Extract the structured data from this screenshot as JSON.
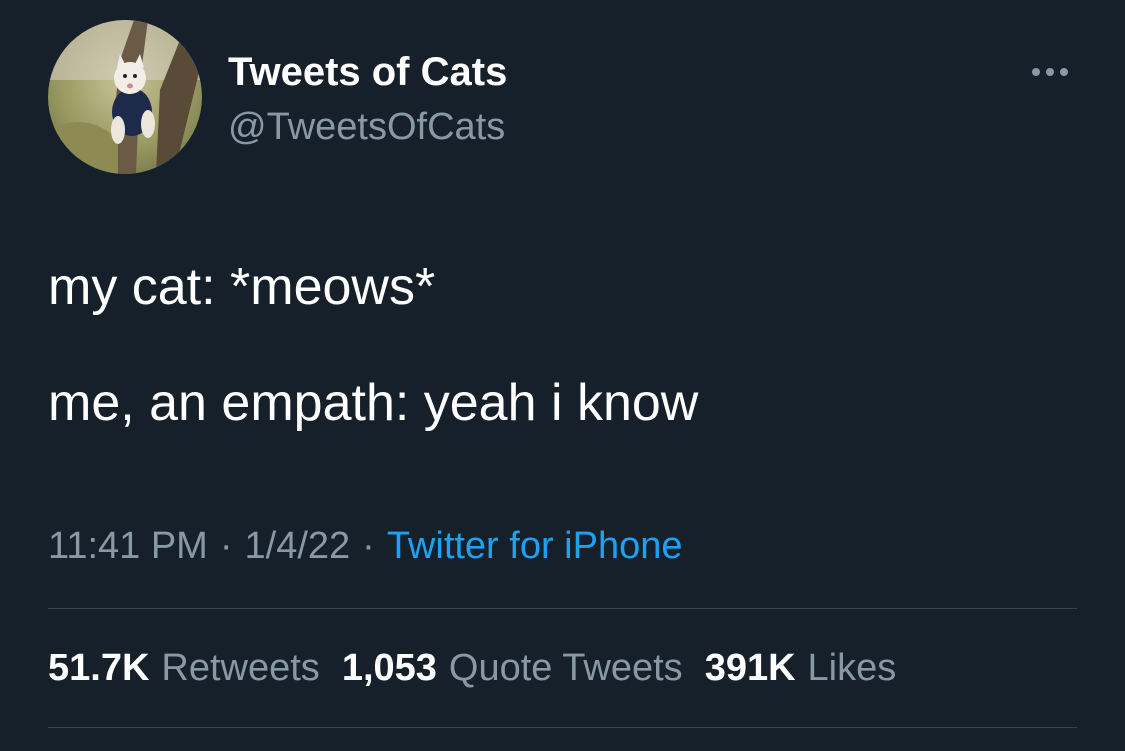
{
  "author": {
    "display_name": "Tweets of Cats",
    "handle": "@TweetsOfCats",
    "avatar_icon": "cat-in-tree-avatar"
  },
  "more_icon": "more-horizontal-icon",
  "tweet": {
    "lines": [
      "my cat: *meows*",
      "me, an empath: yeah i know"
    ]
  },
  "meta": {
    "time": "11:41 PM",
    "date": "1/4/22",
    "separator": "·",
    "source": "Twitter for iPhone"
  },
  "stats": {
    "retweets_count": "51.7K",
    "retweets_label": "Retweets",
    "quotes_count": "1,053",
    "quotes_label": "Quote Tweets",
    "likes_count": "391K",
    "likes_label": "Likes"
  },
  "colors": {
    "background": "#15202b",
    "primary_text": "#ffffff",
    "secondary_text": "#8899a6",
    "link": "#1da1f2",
    "divider": "#38444d"
  }
}
